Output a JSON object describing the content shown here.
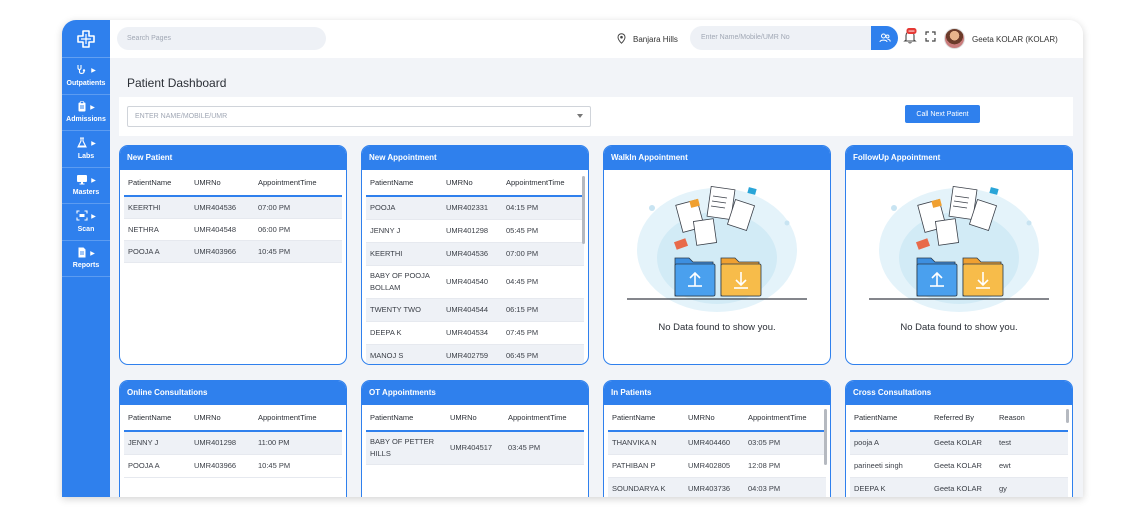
{
  "search": {
    "placeholder": "Search Pages"
  },
  "nav": [
    {
      "label": "Outpatients",
      "icon": "stethoscope-icon"
    },
    {
      "label": "Admissions",
      "icon": "clipboard-icon"
    },
    {
      "label": "Labs",
      "icon": "flask-icon"
    },
    {
      "label": "Masters",
      "icon": "monitor-icon"
    },
    {
      "label": "Scan",
      "icon": "scan-icon"
    },
    {
      "label": "Reports",
      "icon": "report-icon"
    }
  ],
  "topbar": {
    "location": "Banjara Hills",
    "patient_search_placeholder": "Enter Name/Mobile/UMR No",
    "user_name": "Geeta KOLAR (KOLAR)"
  },
  "page": {
    "title": "Patient Dashboard",
    "patient_select_placeholder": "ENTER NAME/MOBILE/UMR",
    "call_next_label": "Call Next Patient"
  },
  "cards": {
    "new_patient": {
      "title": "New Patient",
      "columns": [
        "PatientName",
        "UMRNo",
        "AppointmentTime"
      ],
      "rows": [
        [
          "KEERTHI",
          "UMR404536",
          "07:00 PM"
        ],
        [
          "NETHRA",
          "UMR404548",
          "06:00 PM"
        ],
        [
          "POOJA A",
          "UMR403966",
          "10:45 PM"
        ]
      ]
    },
    "new_appointment": {
      "title": "New Appointment",
      "columns": [
        "PatientName",
        "UMRNo",
        "AppointmentTime"
      ],
      "rows": [
        [
          "POOJA",
          "UMR402331",
          "04:15 PM"
        ],
        [
          "JENNY J",
          "UMR401298",
          "05:45 PM"
        ],
        [
          "KEERTHI",
          "UMR404536",
          "07:00 PM"
        ],
        [
          "BABY OF POOJA BOLLAM",
          "UMR404540",
          "04:45 PM"
        ],
        [
          "TWENTY TWO",
          "UMR404544",
          "06:15 PM"
        ],
        [
          "DEEPA K",
          "UMR404534",
          "07:45 PM"
        ],
        [
          "MANOJ S",
          "UMR402759",
          "06:45 PM"
        ]
      ]
    },
    "walkin": {
      "title": "WalkIn Appointment",
      "empty_text": "No Data found to show you."
    },
    "followup": {
      "title": "FollowUp Appointment",
      "empty_text": "No Data found to show you."
    },
    "online": {
      "title": "Online Consultations",
      "columns": [
        "PatientName",
        "UMRNo",
        "AppointmentTime"
      ],
      "rows": [
        [
          "JENNY J",
          "UMR401298",
          "11:00 PM"
        ],
        [
          "POOJA A",
          "UMR403966",
          "10:45 PM"
        ]
      ]
    },
    "ot": {
      "title": "OT Appointments",
      "columns": [
        "PatientName",
        "UMRNo",
        "AppointmentTime"
      ],
      "rows": [
        [
          "BABY OF PETTER HILLS",
          "UMR404517",
          "03:45 PM"
        ]
      ]
    },
    "inpatients": {
      "title": "In Patients",
      "columns": [
        "PatientName",
        "UMRNo",
        "AppointmentTime"
      ],
      "rows": [
        [
          "THANVIKA N",
          "UMR404460",
          "03:05 PM"
        ],
        [
          "PATHIBAN P",
          "UMR402805",
          "12:08 PM"
        ],
        [
          "SOUNDARYA K",
          "UMR403736",
          "04:03 PM"
        ]
      ]
    },
    "cross": {
      "title": "Cross Consultations",
      "columns": [
        "PatientName",
        "Referred By",
        "Reason"
      ],
      "rows": [
        [
          "pooja A",
          "Geeta KOLAR",
          "test"
        ],
        [
          "parineeti singh",
          "Geeta KOLAR",
          "ewt"
        ],
        [
          "DEEPA K",
          "Geeta KOLAR",
          "gy"
        ]
      ]
    }
  },
  "colors": {
    "primary": "#2f80ed",
    "background": "#f2f4f8",
    "badge": "#e53935"
  }
}
